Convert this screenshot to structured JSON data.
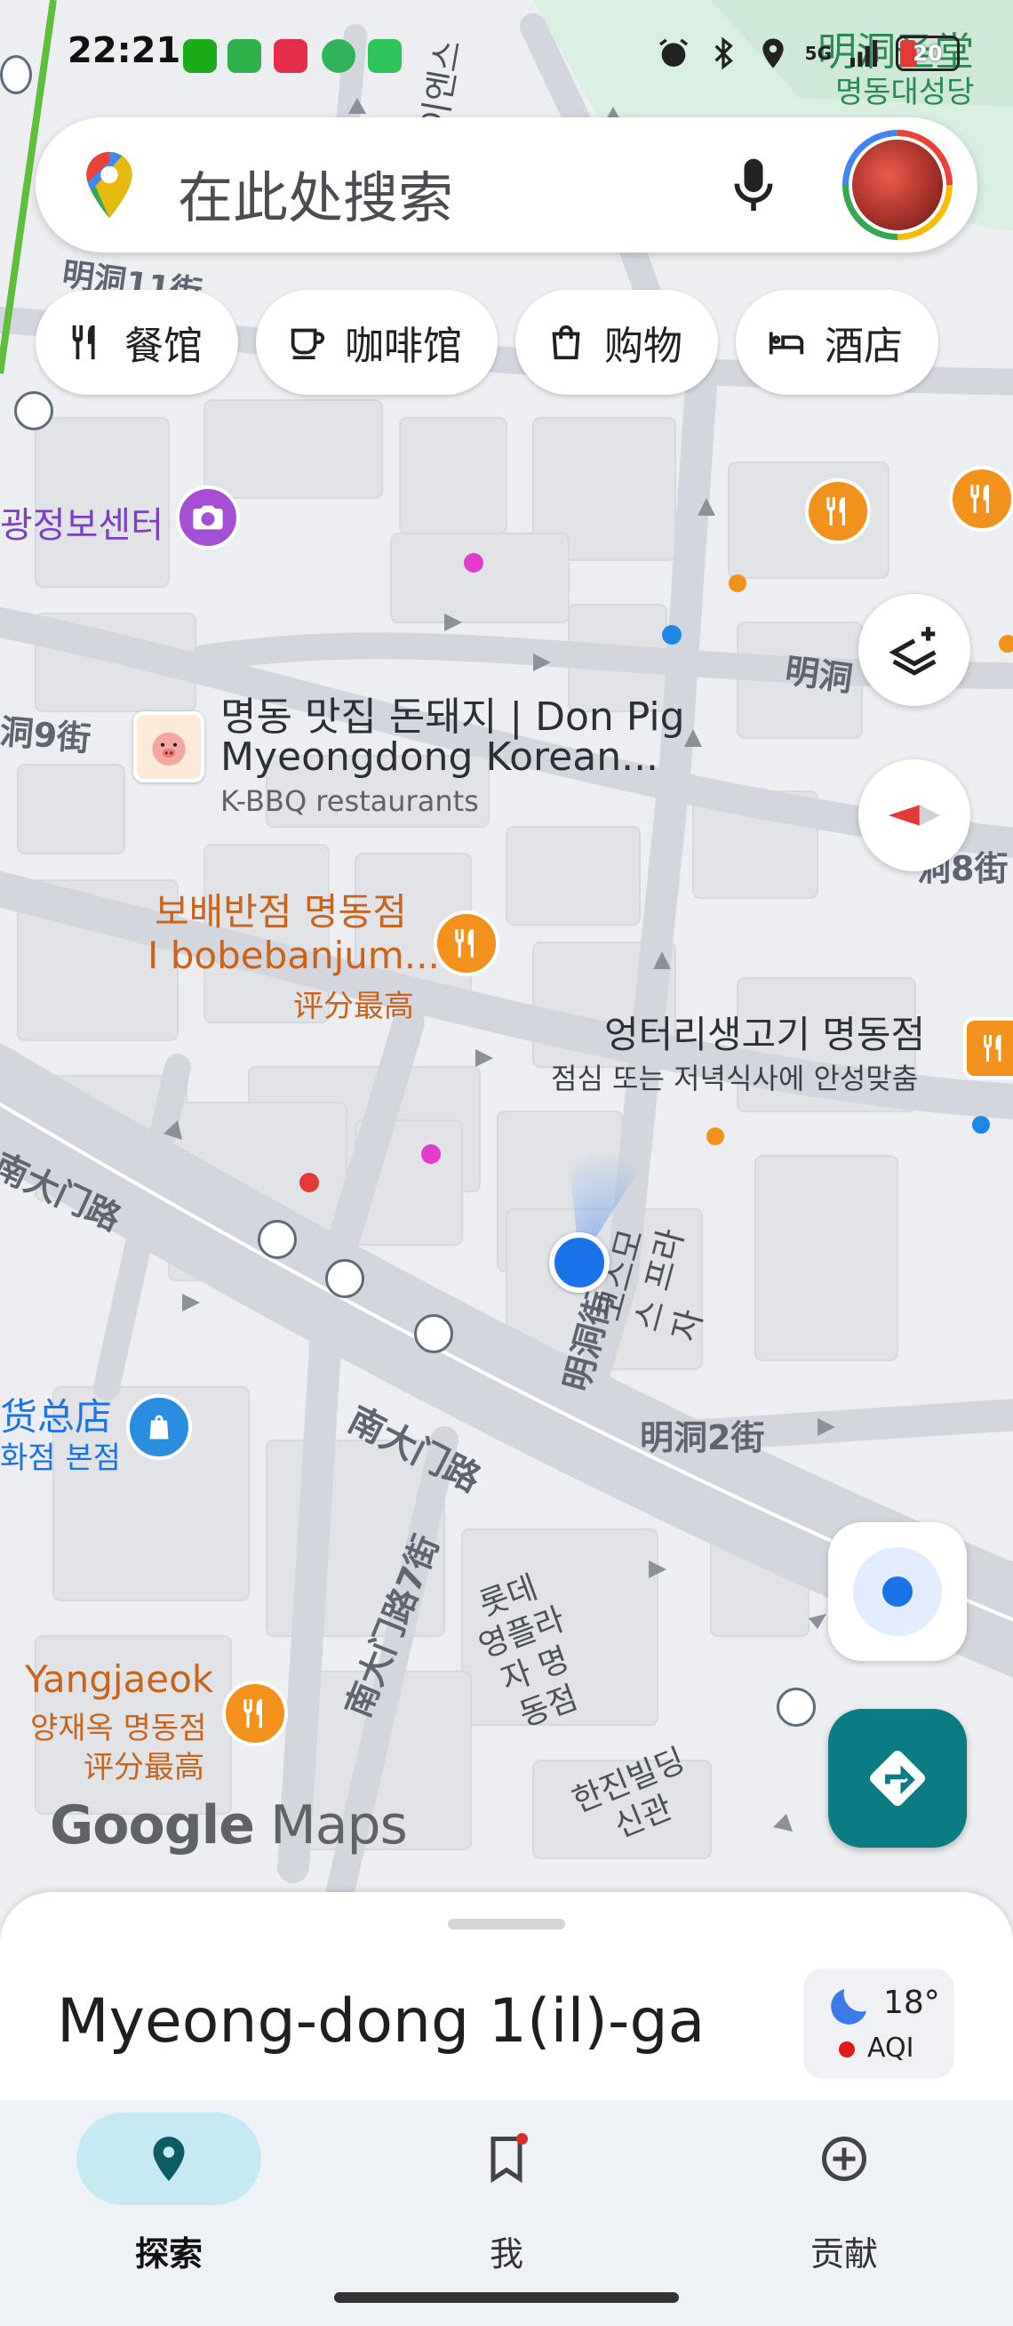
{
  "status_bar": {
    "time": "22:21",
    "network": "5G",
    "battery": "20"
  },
  "search": {
    "placeholder": "在此处搜索",
    "icons": [
      "maps-pin-icon",
      "mic-icon",
      "avatar"
    ]
  },
  "chips": [
    {
      "label": "餐馆",
      "icon": "restaurant-icon"
    },
    {
      "label": "咖啡馆",
      "icon": "coffee-icon"
    },
    {
      "label": "购物",
      "icon": "shopping-bag-icon"
    },
    {
      "label": "酒店",
      "icon": "bed-icon"
    }
  ],
  "map": {
    "streets": {
      "myeongdong_11": "明洞11街",
      "myeongdong_9": "洞9街",
      "myeongdong_8": "洞8街",
      "myeongdong": "明洞",
      "myeongdong_2": "明洞2街",
      "myeongdong_gil": "明洞街",
      "namdaemun_1": "南大门路",
      "namdaemun_2": "南大门路",
      "namdaemun_7": "南大门路7街"
    },
    "cathedral_cn": "明洞圣堂",
    "cathedral_kr": "명동대성당",
    "ineuiseu": "대이엔스",
    "info_center": "광정보센터",
    "pois": {
      "donpig_kr": "명동 맛집 돈돼지 | Don Pig",
      "donpig_en": "Myeongdong Korean...",
      "donpig_cat": "K-BBQ restaurants",
      "bobeban_kr": "보배반점 명동점",
      "bobeban_en": "I bobebanjum...",
      "bobeban_note": "评分最高",
      "eongteori_kr": "엉터리생고기 명동점",
      "eongteori_note": "점심 또는 저녁식사에 안성맞춤",
      "costco": "코스모스 프라자",
      "dept_cn": "货总店",
      "dept_kr": "화점 본점",
      "lotte_young": "롯데 영플라자 명동점",
      "yangjaeok_en": "Yangjaeok",
      "yangjaeok_kr": "양재옥 명동점",
      "yangjaeok_note": "评分最高",
      "hanjin": "한진빌딩 신관"
    }
  },
  "logo": {
    "google": "Google",
    "maps": "Maps"
  },
  "sheet": {
    "place": "Myeong-dong 1(il)-ga",
    "weather_temp": "18°",
    "weather_aqi": "AQI"
  },
  "nav": {
    "items": [
      {
        "label": "探索",
        "icon": "location-pin-icon",
        "active": true
      },
      {
        "label": "我",
        "icon": "bookmark-icon",
        "active": false
      },
      {
        "label": "贡献",
        "icon": "add-circle-icon",
        "active": false
      }
    ]
  },
  "colors": {
    "accent": "#0b7c84",
    "poi_orange": "#f2921d",
    "location_blue": "#1a73e8",
    "nav_active": "#c6eaf3"
  }
}
